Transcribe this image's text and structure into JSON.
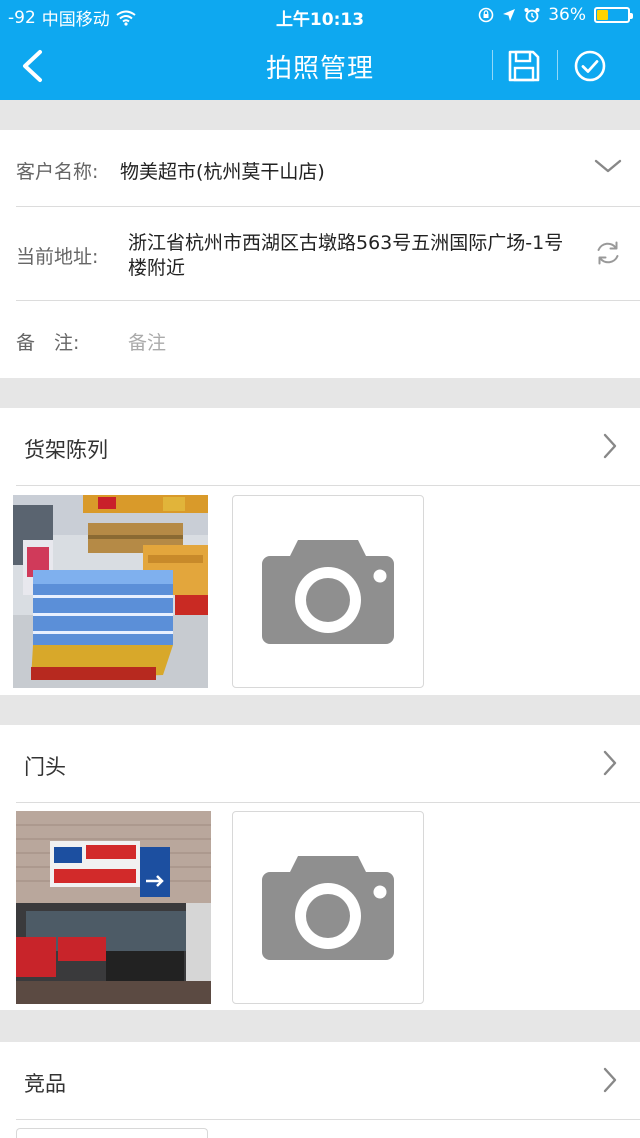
{
  "status_bar": {
    "signal": "-92",
    "carrier": "中国移动",
    "time": "上午10:13",
    "battery_percent": "36%",
    "battery_level": 0.36
  },
  "nav": {
    "title": "拍照管理",
    "back_icon": "chevron-left-icon",
    "save_icon": "floppy-disk-icon",
    "confirm_icon": "check-circle-icon"
  },
  "form": {
    "customer_label": "客户名称:",
    "customer_value": "物美超市(杭州莫干山店)",
    "address_label": "当前地址:",
    "address_value": "浙江省杭州市西湖区古墩路563号五洲国际广场-1号楼附近",
    "note_label": "备　注:",
    "note_placeholder": "备注"
  },
  "sections": [
    {
      "title": "货架陈列"
    },
    {
      "title": "门头"
    },
    {
      "title": "竞品"
    }
  ],
  "colors": {
    "header_bg": "#0ea8f0",
    "page_bg": "#e6e6e6",
    "camera_gray": "#8f8f8f"
  }
}
